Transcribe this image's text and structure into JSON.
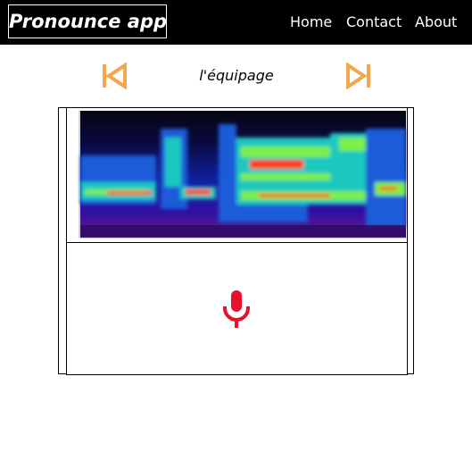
{
  "navbar": {
    "brand": "Pronounce app",
    "links": [
      "Home",
      "Contact",
      "About"
    ]
  },
  "word": "l'équipage",
  "colors": {
    "accent": "#f5a64a",
    "mic": "#e8112d",
    "navbar_bg": "#000000"
  },
  "icons": {
    "previous": "skip-previous-icon",
    "next": "skip-next-icon",
    "record": "microphone-icon"
  }
}
